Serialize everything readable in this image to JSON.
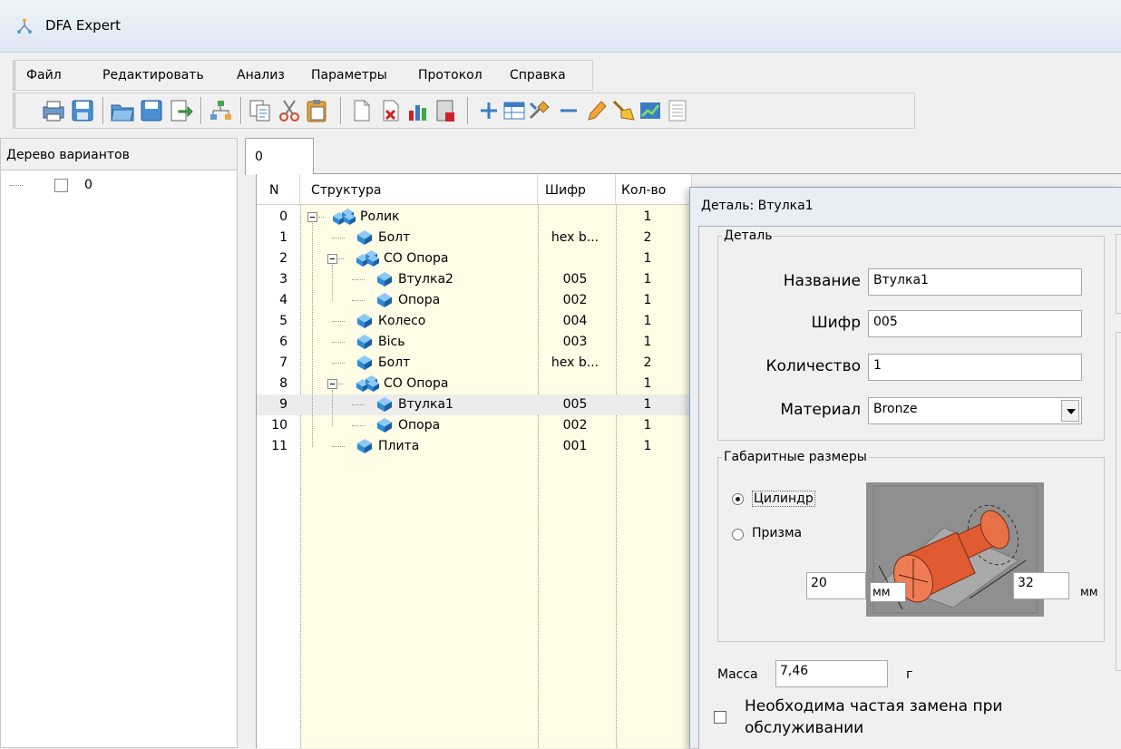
{
  "window": {
    "title": "DFA Expert"
  },
  "menu": [
    "Файл",
    "Редактировать",
    "Анализ",
    "Параметры",
    "Протокол",
    "Справка"
  ],
  "toolbar_icons": [
    "print-icon",
    "save-icon",
    "open-folder-icon",
    "save-disk-icon",
    "export-icon",
    "tree-structure-icon",
    "copy-icon",
    "cut-icon",
    "paste-icon",
    "new-document-icon",
    "delete-icon",
    "bar-chart-icon",
    "report-icon",
    "add-icon",
    "table-icon",
    "tools-icon",
    "remove-icon",
    "edit-pencil-icon",
    "clean-broom-icon",
    "trend-chart-icon",
    "list-icon"
  ],
  "variants": {
    "header": "Дерево вариантов",
    "items": [
      {
        "label": "0",
        "checked": false
      }
    ]
  },
  "tabs": [
    {
      "label": "0"
    }
  ],
  "grid": {
    "columns": [
      "N",
      "Структура",
      "Шифр",
      "Кол-во"
    ],
    "rows": [
      {
        "n": "0",
        "name": "Ролик",
        "code": "",
        "qty": "1",
        "level": 0,
        "type": "assembly",
        "expanded": true
      },
      {
        "n": "1",
        "name": "Болт",
        "code": "hex b...",
        "qty": "2",
        "level": 1,
        "type": "part"
      },
      {
        "n": "2",
        "name": "СО Опора",
        "code": "",
        "qty": "1",
        "level": 1,
        "type": "assembly",
        "expanded": true
      },
      {
        "n": "3",
        "name": "Втулка2",
        "code": "005",
        "qty": "1",
        "level": 2,
        "type": "part"
      },
      {
        "n": "4",
        "name": "Опора",
        "code": "002",
        "qty": "1",
        "level": 2,
        "type": "part"
      },
      {
        "n": "5",
        "name": "Колесо",
        "code": "004",
        "qty": "1",
        "level": 1,
        "type": "part"
      },
      {
        "n": "6",
        "name": "Вісь",
        "code": "003",
        "qty": "1",
        "level": 1,
        "type": "part"
      },
      {
        "n": "7",
        "name": "Болт",
        "code": "hex b...",
        "qty": "2",
        "level": 1,
        "type": "part"
      },
      {
        "n": "8",
        "name": "СО Опора",
        "code": "",
        "qty": "1",
        "level": 1,
        "type": "assembly",
        "expanded": true
      },
      {
        "n": "9",
        "name": "Втулка1",
        "code": "005",
        "qty": "1",
        "level": 2,
        "type": "part",
        "selected": true
      },
      {
        "n": "10",
        "name": "Опора",
        "code": "002",
        "qty": "1",
        "level": 2,
        "type": "part"
      },
      {
        "n": "11",
        "name": "Плита",
        "code": "001",
        "qty": "1",
        "level": 1,
        "type": "part"
      }
    ]
  },
  "dialog": {
    "title": "Деталь: Втулка1",
    "part_group": "Деталь",
    "name_label": "Название",
    "name_value": "Втулка1",
    "code_label": "Шифр",
    "code_value": "005",
    "qty_label": "Количество",
    "qty_value": "1",
    "material_label": "Материал",
    "material_value": "Bronze",
    "dims_group": "Габаритные размеры",
    "shape_cylinder": "Цилиндр",
    "shape_prism": "Призма",
    "selected_shape": "Цилиндр",
    "dim_diameter": "20",
    "dim_length": "32",
    "unit_mm": "мм",
    "mass_label": "Масса",
    "mass_value": "7,46",
    "mass_unit": "г",
    "replace_label_line1": "Необходима частая замена при",
    "replace_label_line2": "обслуживании",
    "replace_checked": false
  },
  "colors": {
    "part_cube": "#2e8bd6",
    "part_red": "#e05a32",
    "grid_yellow": "#fffde6"
  }
}
